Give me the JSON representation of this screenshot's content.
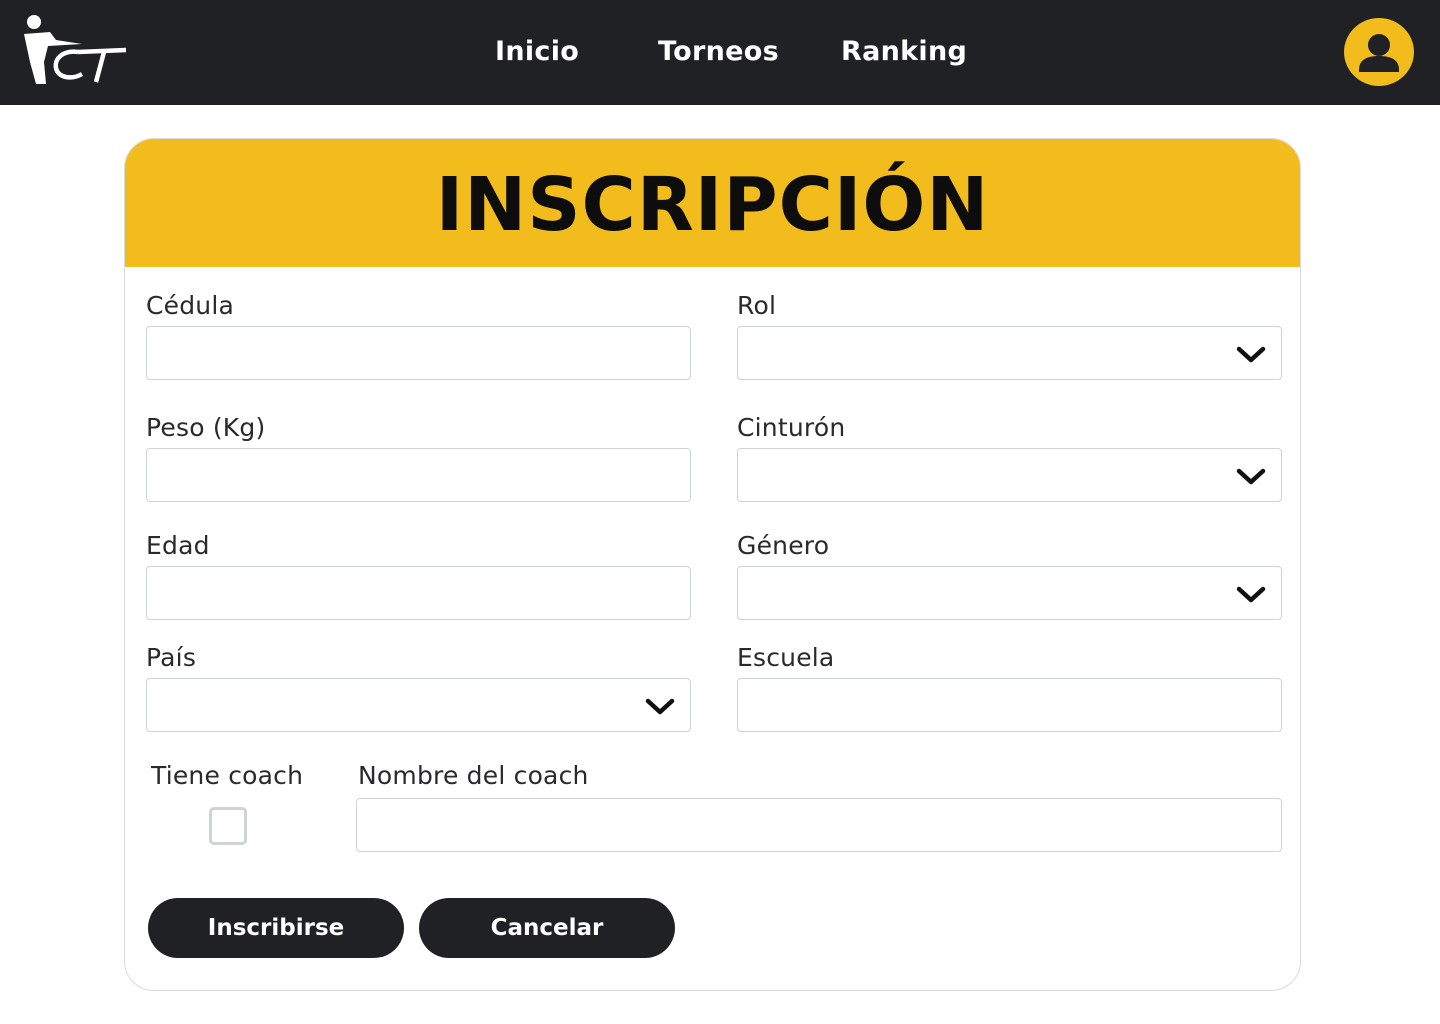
{
  "nav": {
    "links": [
      "Inicio",
      "Torneos",
      "Ranking"
    ]
  },
  "form": {
    "title": "INSCRIPCIÓN",
    "fields": {
      "cedula": {
        "label": "Cédula",
        "value": ""
      },
      "rol": {
        "label": "Rol",
        "value": ""
      },
      "peso": {
        "label": "Peso (Kg)",
        "value": ""
      },
      "cinturon": {
        "label": "Cinturón",
        "value": ""
      },
      "edad": {
        "label": "Edad",
        "value": ""
      },
      "genero": {
        "label": "Género",
        "value": ""
      },
      "pais": {
        "label": "País",
        "value": ""
      },
      "escuela": {
        "label": "Escuela",
        "value": ""
      },
      "tiene_coach": {
        "label": "Tiene coach",
        "checked": false
      },
      "nombre_coach": {
        "label": "Nombre del coach",
        "value": ""
      }
    },
    "buttons": {
      "submit": "Inscribirse",
      "cancel": "Cancelar"
    }
  },
  "icons": {
    "logo": "fct-logo-icon",
    "avatar": "user-icon",
    "dropdown": "chevron-down-icon"
  },
  "colors": {
    "topbar": "#202125",
    "accent": "#f1bc1c",
    "button": "#202125",
    "border": "#cfd3d8"
  }
}
